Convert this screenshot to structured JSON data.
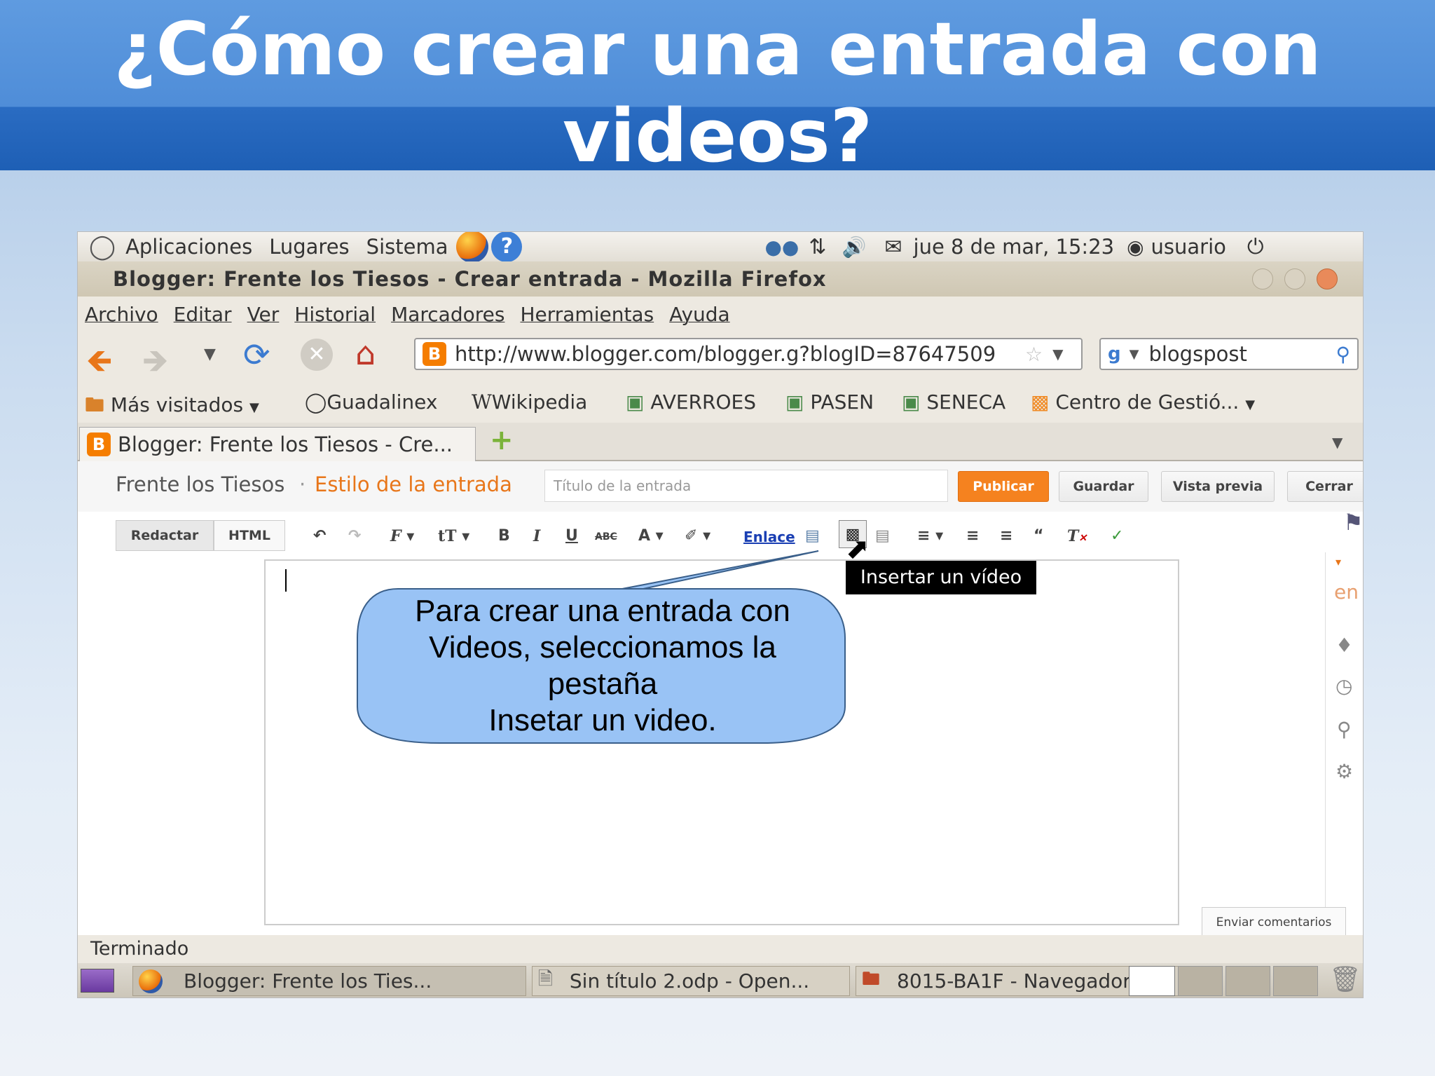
{
  "slide": {
    "title_line1": "¿Cómo crear una entrada con",
    "title_line2": "videos?"
  },
  "gnome_panel": {
    "menus": [
      "Aplicaciones",
      "Lugares",
      "Sistema"
    ],
    "clock": "jue  8 de mar, 15:23",
    "user": "usuario"
  },
  "window": {
    "title": "Blogger: Frente los Tiesos - Crear entrada - Mozilla Firefox"
  },
  "menubar": [
    "Archivo",
    "Editar",
    "Ver",
    "Historial",
    "Marcadores",
    "Herramientas",
    "Ayuda"
  ],
  "navigation": {
    "url": "http://www.blogger.com/blogger.g?blogID=87647509",
    "search_value": "blogspost"
  },
  "bookmarks": [
    "Más visitados",
    "Guadalinex",
    "Wikipedia",
    "AVERROES",
    "PASEN",
    "SENECA",
    "Centro de Gestió..."
  ],
  "tab": {
    "label": "Blogger: Frente los Tiesos - Cre..."
  },
  "blogger": {
    "blog_name": "Frente los Tiesos",
    "separator": "·",
    "section": "Estilo de la entrada",
    "title_placeholder": "Título de la entrada",
    "buttons": {
      "publish": "Publicar",
      "save": "Guardar",
      "preview": "Vista previa",
      "close": "Cerrar"
    },
    "modes": {
      "compose": "Redactar",
      "html": "HTML"
    },
    "link_label": "Enlace",
    "tooltip": "Insertar un vídeo",
    "feedback": "Enviar comentarios",
    "sidebar_partial": "en"
  },
  "callout": {
    "line1": "Para crear una entrada con",
    "line2": "Videos, seleccionamos la",
    "line3": "pestaña",
    "line4": "Insetar un video."
  },
  "status": "Terminado",
  "taskbar": {
    "items": [
      "Blogger: Frente los Ties...",
      "Sin título 2.odp - Open...",
      "8015-BA1F - Navegador..."
    ]
  },
  "colors": {
    "title_band": "#4f8dd8",
    "publish_orange": "#f5821f",
    "callout_fill": "#99c3f5",
    "section_orange": "#e8761a"
  }
}
